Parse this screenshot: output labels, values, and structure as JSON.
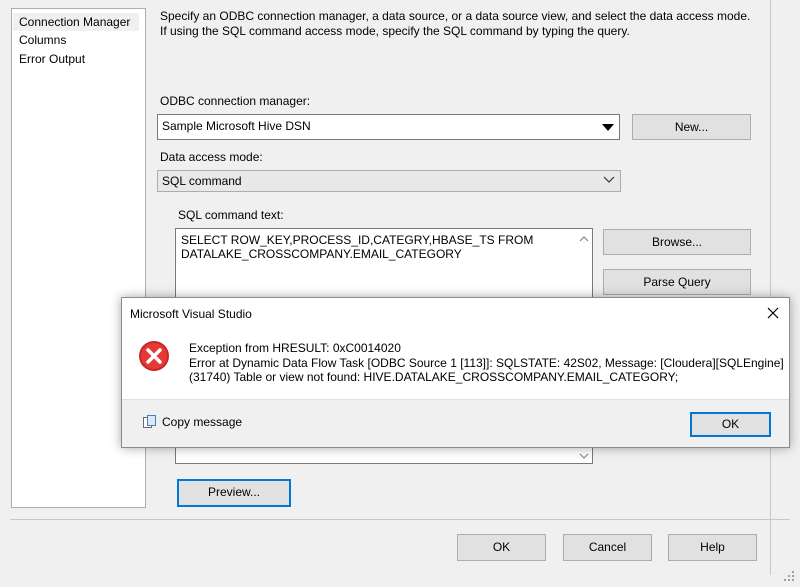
{
  "nav": {
    "items": [
      "Connection Manager",
      "Columns",
      "Error Output"
    ]
  },
  "description": "Specify an ODBC connection manager, a data source, or a data source view, and select the data access mode. If using the SQL command access mode, specify the SQL command by typing the query.",
  "odbc": {
    "label": "ODBC connection manager:",
    "value": "Sample Microsoft Hive DSN",
    "new_label": "New..."
  },
  "access_mode": {
    "label": "Data access mode:",
    "value": "SQL command"
  },
  "sql": {
    "label": "SQL command text:",
    "line1": "SELECT ROW_KEY,PROCESS_ID,CATEGRY,HBASE_TS FROM",
    "line2": "DATALAKE_CROSSCOMPANY.EMAIL_CATEGORY",
    "browse_label": "Browse...",
    "parse_label": "Parse Query"
  },
  "preview_label": "Preview...",
  "footer": {
    "ok": "OK",
    "cancel": "Cancel",
    "help": "Help"
  },
  "dialog": {
    "title": "Microsoft Visual Studio",
    "line1": "Exception from HRESULT: 0xC0014020",
    "line2": "Error at Dynamic Data Flow Task [ODBC Source 1 [113]]: SQLSTATE: 42S02, Message: [Cloudera][SQLEngine]",
    "line3": "(31740) Table or view not found: HIVE.DATALAKE_CROSSCOMPANY.EMAIL_CATEGORY;",
    "copy_label": "Copy message",
    "ok_label": "OK"
  },
  "icons": {
    "error": "error-icon",
    "close": "close-icon",
    "copy": "copy-icon",
    "dropdown": "chevron-down-icon"
  },
  "colors": {
    "error_red": "#d32f2f",
    "focus_blue": "#0078d7"
  }
}
